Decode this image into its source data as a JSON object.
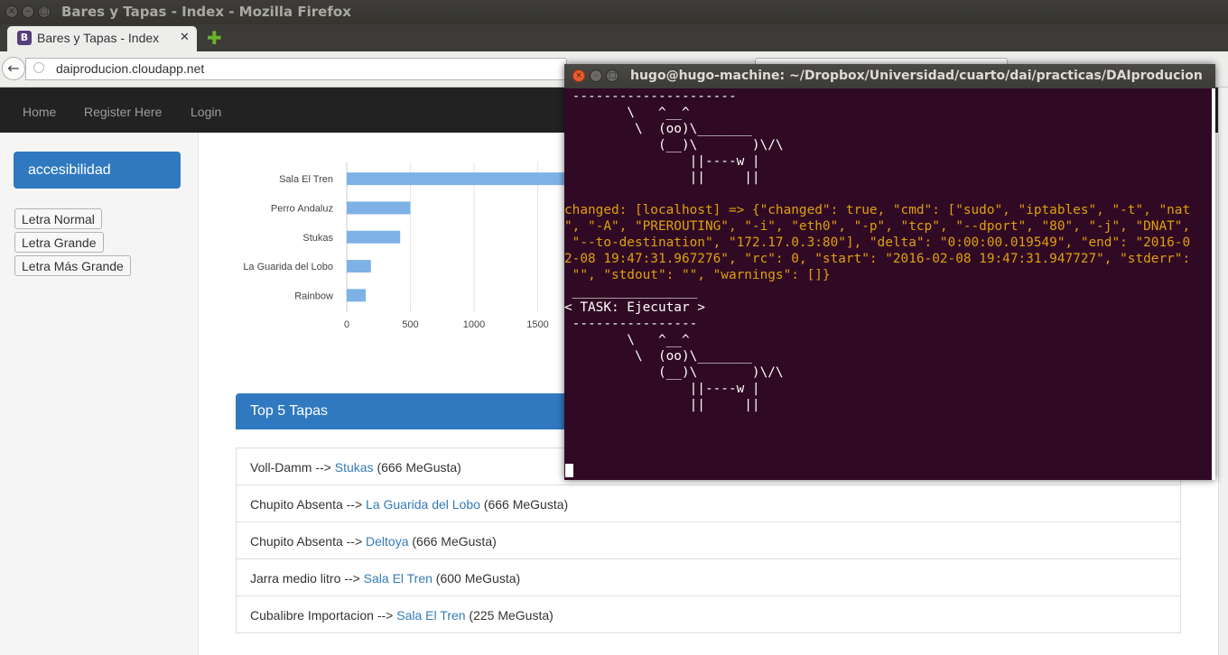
{
  "browser": {
    "window_title": "Bares y Tapas - Index - Mozilla Firefox",
    "tab_title": "Bares y Tapas - Index",
    "tab_close": "✕",
    "new_tab": "✚",
    "url": "daiproducion.cloudapp.net",
    "favicon_letter": "B"
  },
  "site_nav": {
    "items": [
      "Home",
      "Register Here",
      "Login"
    ]
  },
  "sidebar": {
    "accessibility_label": "accesibilidad",
    "font_buttons": [
      "Letra Normal",
      "Letra Grande",
      "Letra Más Grande"
    ]
  },
  "chart_data": {
    "type": "bar",
    "orientation": "horizontal",
    "categories": [
      "Sala El Tren",
      "Perro Andaluz",
      "Stukas",
      "La Guarida del Lobo",
      "Rainbow"
    ],
    "values": [
      1800,
      500,
      420,
      190,
      150
    ],
    "x_ticks": [
      "0",
      "500",
      "1000",
      "1500"
    ],
    "xlim": [
      0,
      2000
    ],
    "bar_color": "#7eb2e6",
    "grid": true
  },
  "top5": {
    "title": "Top 5 Tapas",
    "rows": [
      {
        "tapa": "Voll-Damm",
        "arrow": " --> ",
        "bar": "Stukas",
        "likes": " (666 MeGusta)"
      },
      {
        "tapa": "Chupito Absenta",
        "arrow": " --> ",
        "bar": "La Guarida del Lobo",
        "likes": " (666 MeGusta)"
      },
      {
        "tapa": "Chupito Absenta",
        "arrow": " --> ",
        "bar": "Deltoya",
        "likes": " (666 MeGusta)"
      },
      {
        "tapa": "Jarra medio litro",
        "arrow": " --> ",
        "bar": "Sala El Tren",
        "likes": " (600 MeGusta)"
      },
      {
        "tapa": "Cubalibre Importacion",
        "arrow": " --> ",
        "bar": "Sala El Tren",
        "likes": " (225 MeGusta)"
      }
    ]
  },
  "terminal": {
    "title": "hugo@hugo-machine: ~/Dropbox/Universidad/cuarto/dai/practicas/DAIproducion",
    "cow1": " ---------------------\n        \\   ^__^\n         \\  (oo)\\_______\n            (__)\\       )\\/\\\n                ||----w |\n                ||     ||\n\n",
    "changed": "changed: [localhost] => {\"changed\": true, \"cmd\": [\"sudo\", \"iptables\", \"-t\", \"nat\n\", \"-A\", \"PREROUTING\", \"-i\", \"eth0\", \"-p\", \"tcp\", \"--dport\", \"80\", \"-j\", \"DNAT\",\n \"--to-destination\", \"172.17.0.3:80\"], \"delta\": \"0:00:00.019549\", \"end\": \"2016-0\n2-08 19:47:31.967276\", \"rc\": 0, \"start\": \"2016-02-08 19:47:31.947727\", \"stderr\":\n \"\", \"stdout\": \"\", \"warnings\": []}",
    "task": " ________________\n< TASK: Ejecutar >\n ----------------\n        \\   ^__^\n         \\  (oo)\\_______\n            (__)\\       )\\/\\\n                ||----w |\n                ||     ||",
    "colors": {
      "background": "#300a24",
      "changed_text": "#dea00e"
    }
  }
}
